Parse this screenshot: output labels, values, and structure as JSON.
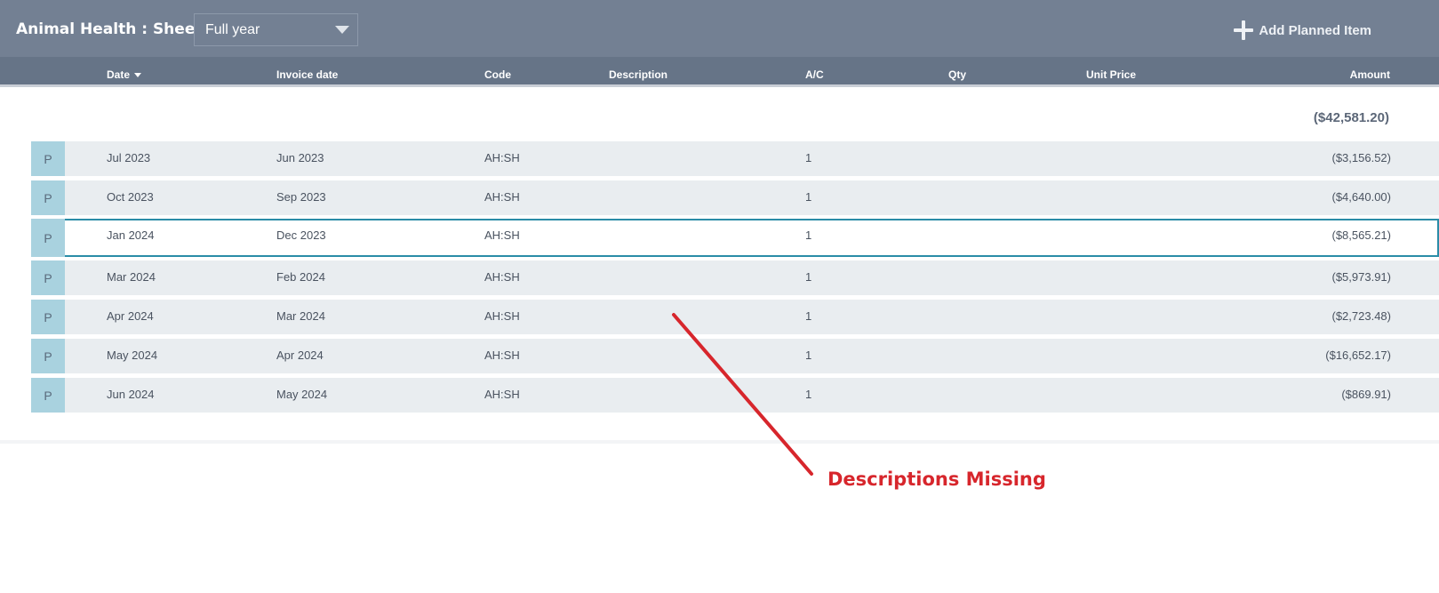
{
  "header": {
    "title": "Animal Health : Sheep",
    "period_select": {
      "value": "Full year"
    },
    "add_button_label": "Add Planned Item"
  },
  "columns": {
    "date": "Date",
    "invoice_date": "Invoice date",
    "code": "Code",
    "description": "Description",
    "ac": "A/C",
    "qty": "Qty",
    "unit_price": "Unit Price",
    "amount": "Amount"
  },
  "total_amount": "($42,581.20)",
  "rows": [
    {
      "badge": "P",
      "date": "Jul 2023",
      "invoice_date": "Jun 2023",
      "code": "AH:SH",
      "description": "",
      "ac": "1",
      "qty": "",
      "unit_price": "",
      "amount": "($3,156.52)"
    },
    {
      "badge": "P",
      "date": "Oct 2023",
      "invoice_date": "Sep 2023",
      "code": "AH:SH",
      "description": "",
      "ac": "1",
      "qty": "",
      "unit_price": "",
      "amount": "($4,640.00)"
    },
    {
      "badge": "P",
      "date": "Jan 2024",
      "invoice_date": "Dec 2023",
      "code": "AH:SH",
      "description": "",
      "ac": "1",
      "qty": "",
      "unit_price": "",
      "amount": "($8,565.21)"
    },
    {
      "badge": "P",
      "date": "Mar 2024",
      "invoice_date": "Feb 2024",
      "code": "AH:SH",
      "description": "",
      "ac": "1",
      "qty": "",
      "unit_price": "",
      "amount": "($5,973.91)"
    },
    {
      "badge": "P",
      "date": "Apr 2024",
      "invoice_date": "Mar 2024",
      "code": "AH:SH",
      "description": "",
      "ac": "1",
      "qty": "",
      "unit_price": "",
      "amount": "($2,723.48)"
    },
    {
      "badge": "P",
      "date": "May 2024",
      "invoice_date": "Apr 2024",
      "code": "AH:SH",
      "description": "",
      "ac": "1",
      "qty": "",
      "unit_price": "",
      "amount": "($16,652.17)"
    },
    {
      "badge": "P",
      "date": "Jun 2024",
      "invoice_date": "May 2024",
      "code": "AH:SH",
      "description": "",
      "ac": "1",
      "qty": "",
      "unit_price": "",
      "amount": "($869.91)"
    }
  ],
  "annotation": {
    "text": "Descriptions Missing",
    "color": "#d7262c"
  },
  "colors": {
    "topbar": "#738093",
    "header_row": "#667487",
    "row_bg": "#e9edf0",
    "badge_bg": "#a9d2df",
    "selected_border": "#2a8ca7"
  }
}
